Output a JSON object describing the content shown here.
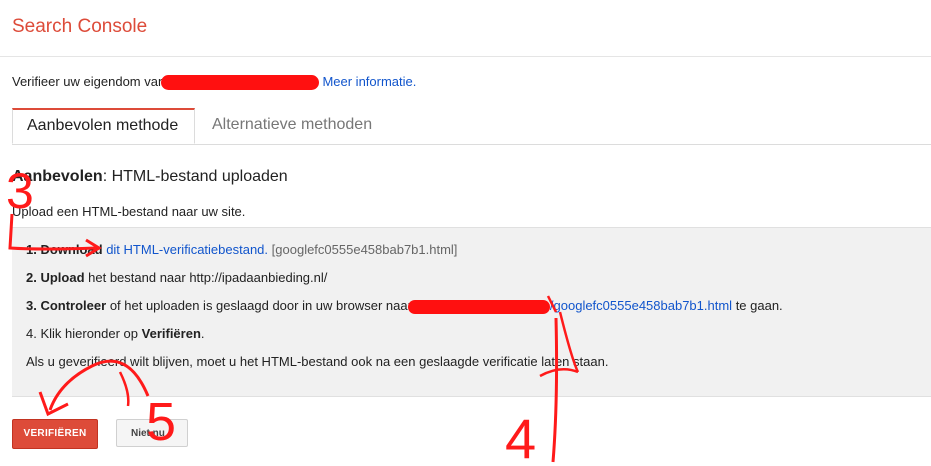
{
  "app": {
    "title": "Search Console"
  },
  "verify": {
    "prefix": "Verifieer uw eigendom van",
    "more_info_link": "Meer informatie."
  },
  "tabs": [
    {
      "label": "Aanbevolen methode",
      "active": true
    },
    {
      "label": "Alternatieve methoden",
      "active": false
    }
  ],
  "section": {
    "title_bold": "Aanbevolen",
    "title_rest": ": HTML-bestand uploaden",
    "description": "Upload een HTML-bestand naar uw site."
  },
  "steps": {
    "s1_bold": "1. Download",
    "s1_link": "dit HTML-verificatiebestand.",
    "s1_file": "[googlefc0555e458bab7b1.html]",
    "s2_bold": "2. Upload",
    "s2_rest": "het bestand naar http://ipadaanbieding.nl/",
    "s3_bold": "3. Controleer",
    "s3_rest": "of het uploaden is geslaagd door in uw browser naar",
    "s3_link": "/googlefc0555e458bab7b1.html",
    "s3_end": "te gaan.",
    "s4_prefix": "4. Klik hieronder op",
    "s4_bold": "Verifiëren",
    "s4_end": ".",
    "note": "Als u geverifieerd wilt blijven, moet u het HTML-bestand ook na een geslaagde verificatie laten staan."
  },
  "buttons": {
    "verify": "VERIFIËREN",
    "secondary": "Niet nu"
  },
  "annotations": {
    "n3": "3",
    "n4": "4",
    "n5": "5",
    "color": "#ff1a1a"
  },
  "colors": {
    "brand": "#dd4b39",
    "link": "#1155cc",
    "redaction": "#ff1010"
  }
}
